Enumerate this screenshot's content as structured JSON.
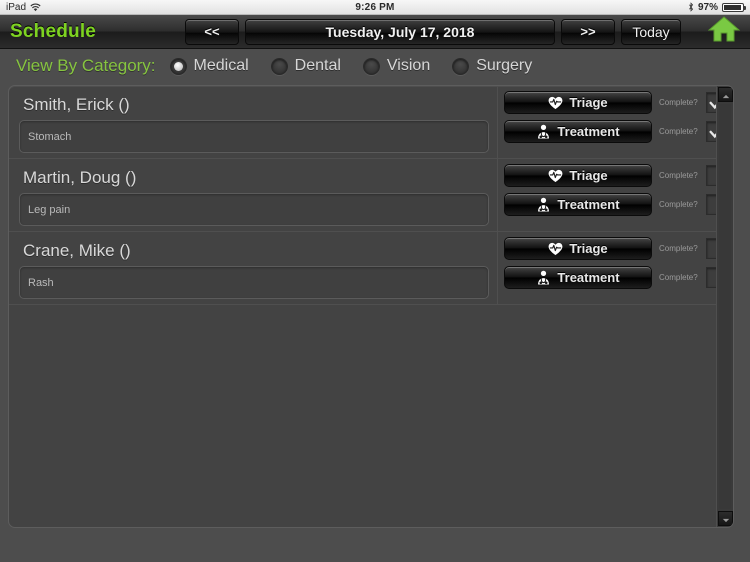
{
  "statusbar": {
    "device": "iPad",
    "wifi_icon": "wifi-icon",
    "time": "9:26 PM",
    "bluetooth_icon": "bluetooth-icon",
    "battery_percent": "97%",
    "battery_icon": "battery-icon"
  },
  "navbar": {
    "app_title": "Schedule",
    "prev_label": "<<",
    "date_label": "Tuesday, July 17, 2018",
    "next_label": ">>",
    "today_label": "Today",
    "home_icon": "home-icon",
    "accent_color": "#7ed321"
  },
  "category_filter": {
    "label": "View By Category:",
    "options": [
      {
        "label": "Medical",
        "selected": true
      },
      {
        "label": "Dental",
        "selected": false
      },
      {
        "label": "Vision",
        "selected": false
      },
      {
        "label": "Surgery",
        "selected": false
      }
    ]
  },
  "list": {
    "complete_label": "Complete?",
    "triage_label": "Triage",
    "triage_icon": "heart-pulse-icon",
    "treatment_label": "Treatment",
    "treatment_icon": "doctor-icon",
    "patients": [
      {
        "name": "Smith, Erick  ()",
        "complaint": "Stomach",
        "triage_complete": true,
        "treatment_complete": true
      },
      {
        "name": "Martin, Doug ()",
        "complaint": "Leg pain",
        "triage_complete": false,
        "treatment_complete": false
      },
      {
        "name": "Crane, Mike ()",
        "complaint": "Rash",
        "triage_complete": false,
        "treatment_complete": false
      }
    ]
  },
  "scrollbar": {
    "up_icon": "chevron-up-icon",
    "down_icon": "chevron-down-icon"
  }
}
